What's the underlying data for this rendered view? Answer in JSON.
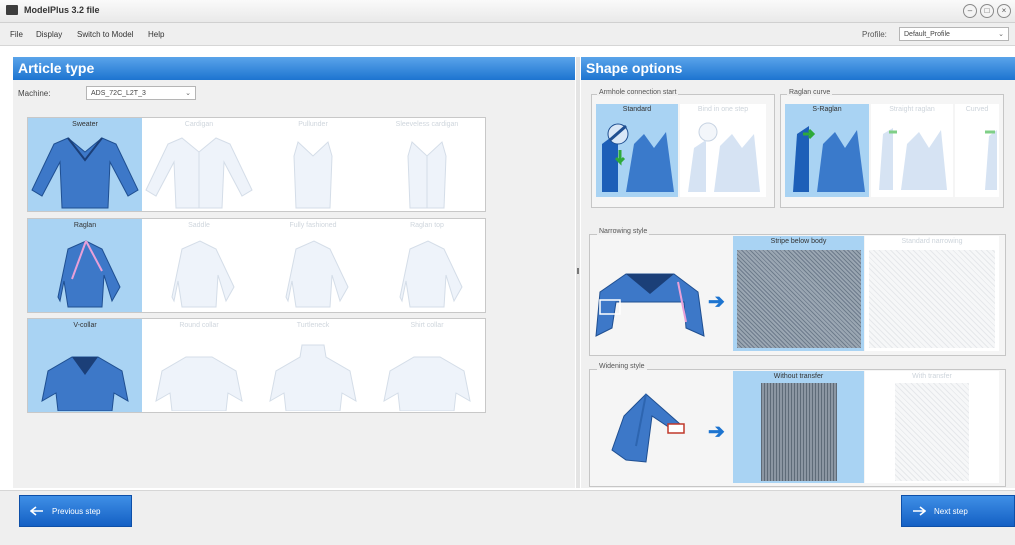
{
  "window": {
    "title": "ModelPlus 3.2 file",
    "minimize": "–",
    "maximize": "□",
    "close": "×"
  },
  "menu": {
    "items": [
      "File",
      "Display",
      "Switch to Model",
      "Help"
    ],
    "profile_label": "Profile:",
    "profile_value": "Default_Profile"
  },
  "left_panel": {
    "header": "Article type",
    "machine_label": "Machine:",
    "machine_value": "ADS_72C_L2T_3",
    "rows": [
      {
        "cells": [
          {
            "label": "Sweater",
            "selected": true
          },
          {
            "label": "Cardigan",
            "selected": false
          },
          {
            "label": "Pullunder",
            "selected": false
          },
          {
            "label": "Sleeveless cardigan",
            "selected": false
          }
        ]
      },
      {
        "cells": [
          {
            "label": "Raglan",
            "selected": true
          },
          {
            "label": "Saddle",
            "selected": false
          },
          {
            "label": "Fully fashioned",
            "selected": false
          },
          {
            "label": "Raglan top",
            "selected": false
          }
        ]
      },
      {
        "cells": [
          {
            "label": "V-collar",
            "selected": true
          },
          {
            "label": "Round collar",
            "selected": false
          },
          {
            "label": "Turtleneck",
            "selected": false
          },
          {
            "label": "Shirt collar",
            "selected": false
          }
        ]
      }
    ]
  },
  "right_panel": {
    "header": "Shape options",
    "armhole": {
      "title": "Armhole connection start",
      "options": [
        {
          "label": "Standard",
          "selected": true
        },
        {
          "label": "Bind in one step",
          "selected": false
        }
      ]
    },
    "raglan": {
      "title": "Raglan curve",
      "options": [
        {
          "label": "S-Raglan",
          "selected": true
        },
        {
          "label": "Straight raglan",
          "selected": false
        },
        {
          "label": "Curved",
          "selected": false
        }
      ]
    },
    "narrowing": {
      "title": "Narrowing style",
      "options": [
        {
          "label": "Stripe below body",
          "selected": true
        },
        {
          "label": "Standard narrowing",
          "selected": false
        }
      ]
    },
    "widening": {
      "title": "Widening style",
      "options": [
        {
          "label": "Without transfer",
          "selected": true
        },
        {
          "label": "With transfer",
          "selected": false
        }
      ]
    }
  },
  "bottom": {
    "prev_label": "Previous step",
    "next_label": "Next step"
  },
  "colors": {
    "accent": "#1d74d0",
    "selected": "#a9d3f3",
    "garment": "#3d78c8"
  }
}
